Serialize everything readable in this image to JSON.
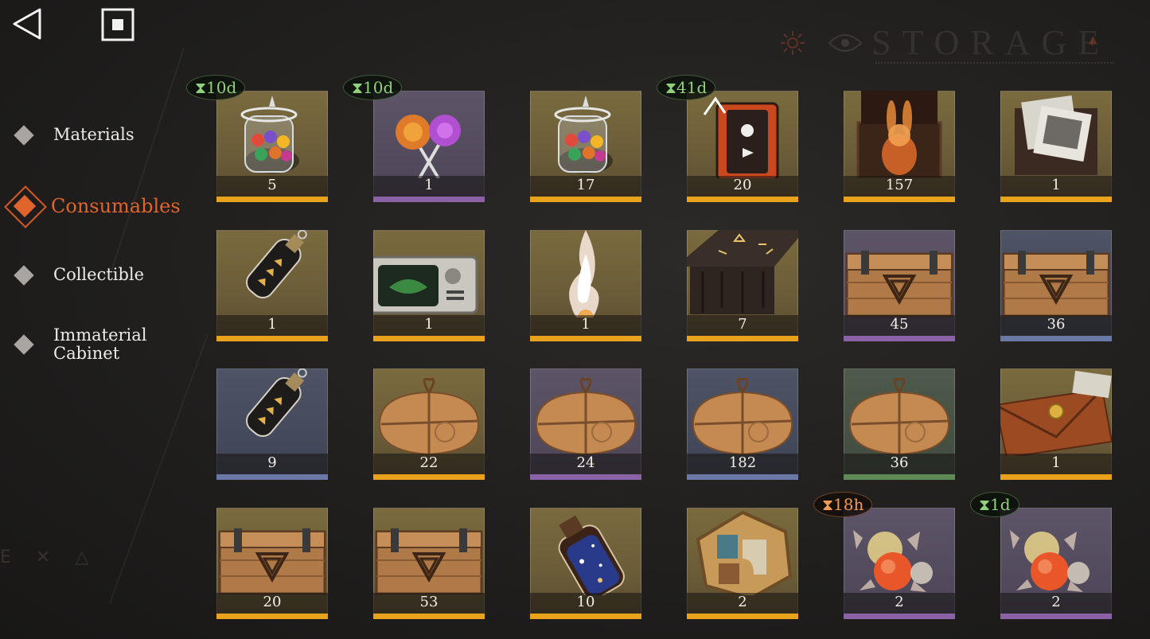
{
  "watermark": "STORAGE",
  "bottom_glyphs": "E ✕ △",
  "nav": {
    "back_icon": "back-triangle-icon",
    "stop_icon": "stop-square-icon"
  },
  "categories": [
    {
      "label": "Materials",
      "active": false
    },
    {
      "label": "Consumables",
      "active": true
    },
    {
      "label": "Collectible",
      "active": false
    },
    {
      "label": "Immaterial Cabinet",
      "active": false
    }
  ],
  "rarity_colors": {
    "gold": "#e8a21b",
    "purple": "#8b62a6",
    "blue": "#6a78a6",
    "green": "#5f8a57"
  },
  "items": [
    {
      "name": "candy-jar",
      "qty": "5",
      "rarity": "gold",
      "timer": "10d",
      "timer_color": "green"
    },
    {
      "name": "lollipops",
      "qty": "1",
      "rarity": "purple",
      "timer": "10d",
      "timer_color": "green"
    },
    {
      "name": "candy-jar",
      "qty": "17",
      "rarity": "gold",
      "timer": "",
      "timer_color": ""
    },
    {
      "name": "cassette-player",
      "qty": "20",
      "rarity": "gold",
      "timer": "41d",
      "timer_color": "green"
    },
    {
      "name": "rabbit-box",
      "qty": "157",
      "rarity": "gold",
      "timer": "",
      "timer_color": ""
    },
    {
      "name": "photo-box",
      "qty": "1",
      "rarity": "gold",
      "timer": "",
      "timer_color": ""
    },
    {
      "name": "bottle-message",
      "qty": "1",
      "rarity": "gold",
      "timer": "",
      "timer_color": ""
    },
    {
      "name": "old-tv",
      "qty": "1",
      "rarity": "gold",
      "timer": "",
      "timer_color": ""
    },
    {
      "name": "spirit-flame",
      "qty": "1",
      "rarity": "gold",
      "timer": "",
      "timer_color": ""
    },
    {
      "name": "rune-table",
      "qty": "7",
      "rarity": "gold",
      "timer": "",
      "timer_color": ""
    },
    {
      "name": "wooden-crate",
      "qty": "45",
      "rarity": "purple",
      "timer": "",
      "timer_color": ""
    },
    {
      "name": "wooden-crate",
      "qty": "36",
      "rarity": "blue",
      "timer": "",
      "timer_color": ""
    },
    {
      "name": "bottle-message",
      "qty": "9",
      "rarity": "blue",
      "timer": "",
      "timer_color": ""
    },
    {
      "name": "paper-parcel",
      "qty": "22",
      "rarity": "gold",
      "timer": "",
      "timer_color": ""
    },
    {
      "name": "paper-parcel",
      "qty": "24",
      "rarity": "purple",
      "timer": "",
      "timer_color": ""
    },
    {
      "name": "paper-parcel",
      "qty": "182",
      "rarity": "blue",
      "timer": "",
      "timer_color": ""
    },
    {
      "name": "paper-parcel",
      "qty": "36",
      "rarity": "green",
      "timer": "",
      "timer_color": ""
    },
    {
      "name": "sealed-envelope",
      "qty": "1",
      "rarity": "gold",
      "timer": "",
      "timer_color": ""
    },
    {
      "name": "wooden-crate",
      "qty": "20",
      "rarity": "gold",
      "timer": "",
      "timer_color": ""
    },
    {
      "name": "wooden-crate",
      "qty": "53",
      "rarity": "gold",
      "timer": "",
      "timer_color": ""
    },
    {
      "name": "galaxy-bottle",
      "qty": "10",
      "rarity": "gold",
      "timer": "",
      "timer_color": ""
    },
    {
      "name": "puzzle-tile",
      "qty": "2",
      "rarity": "gold",
      "timer": "",
      "timer_color": ""
    },
    {
      "name": "wrapped-candies",
      "qty": "2",
      "rarity": "purple",
      "timer": "18h",
      "timer_color": "orange"
    },
    {
      "name": "wrapped-candies",
      "qty": "2",
      "rarity": "purple",
      "timer": "1d",
      "timer_color": "green"
    }
  ]
}
